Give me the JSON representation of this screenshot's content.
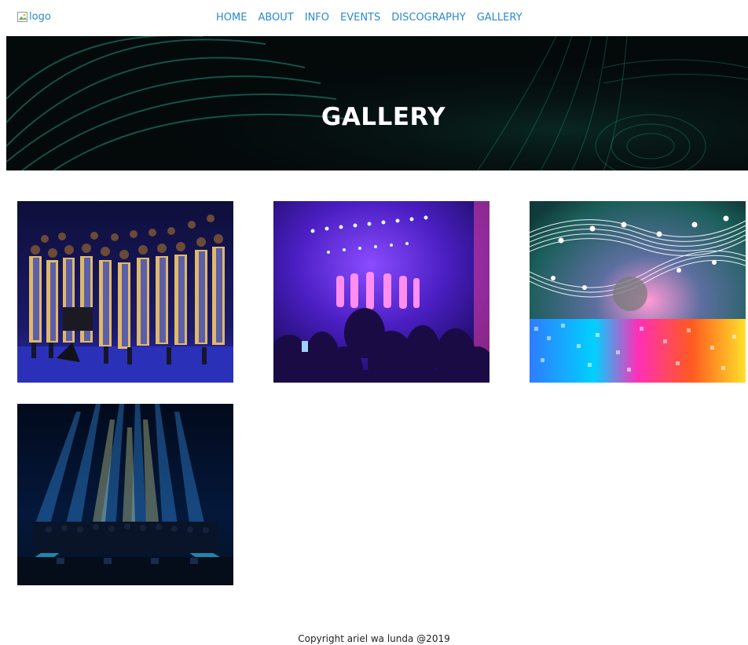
{
  "header": {
    "logo_alt": "logo",
    "nav": [
      {
        "label": "HOME"
      },
      {
        "label": "ABOUT"
      },
      {
        "label": "INFO"
      },
      {
        "label": "EVENTS"
      },
      {
        "label": "DISCOGRAPHY"
      },
      {
        "label": "GALLERY"
      }
    ]
  },
  "hero": {
    "title": "GALLERY"
  },
  "gallery": [
    {
      "subject": "choir-photo"
    },
    {
      "subject": "concert-crowd-photo"
    },
    {
      "subject": "music-notes-equalizer-image"
    },
    {
      "subject": "orchestra-stage-lights-photo"
    }
  ],
  "footer": {
    "copyright": "Copyright ariel wa lunda @2019"
  },
  "colors": {
    "nav_link": "#2a8ad2",
    "hero_bg": "#04090a",
    "hero_accent": "#1f8f7a"
  }
}
